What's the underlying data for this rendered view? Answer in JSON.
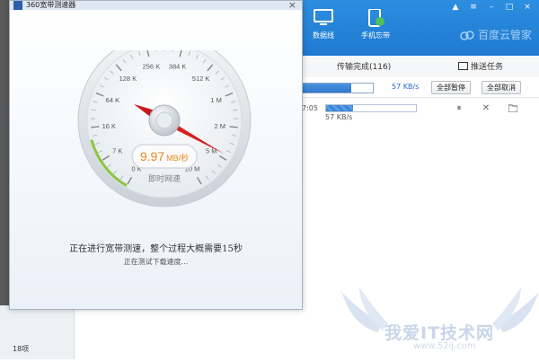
{
  "dialog": {
    "title": "360宽带测速器",
    "close_glyph": "×",
    "gauge": {
      "ticks": [
        "0 K",
        "7 K",
        "16 K",
        "64 K",
        "128 K",
        "256 K",
        "384 K",
        "512 K",
        "1 M",
        "2 M",
        "5 M",
        "10 M"
      ],
      "speed_value": "9.97",
      "speed_unit": "MB/秒",
      "label": "即时网速"
    },
    "status_main": "正在进行宽带测速，整个过程大概需要15秒",
    "status_sub": "正在测试下载速度..."
  },
  "app": {
    "tools": [
      {
        "label": "数据线",
        "icon": "monitor-icon"
      },
      {
        "label": "手机忘带",
        "icon": "phone-cloud-icon"
      }
    ],
    "brand": "百度云管家",
    "tabs": {
      "completed": "传输完成(116)",
      "push": "推送任务"
    },
    "top_speed": "57 KB/s",
    "buttons": {
      "pause_all": "全部暂停",
      "cancel_all": "全部取消"
    },
    "task": {
      "time": "7:05",
      "speed": "57 KB/s"
    },
    "left_count": "18项"
  },
  "watermark": {
    "text": "我爱IT技术网",
    "url": "www.52ij.com"
  },
  "colors": {
    "accent_blue": "#1f7ad0",
    "needle_red": "#d81e1e",
    "speed_orange": "#e7891a"
  }
}
